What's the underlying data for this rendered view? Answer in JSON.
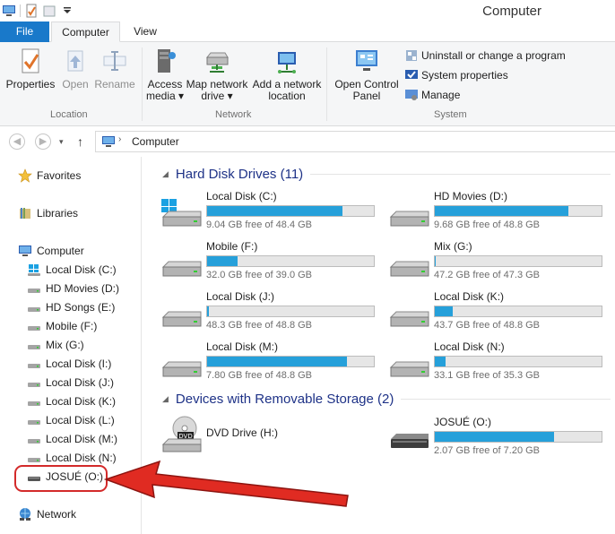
{
  "window": {
    "title": "Computer"
  },
  "tabs": {
    "file": "File",
    "computer": "Computer",
    "view": "View"
  },
  "ribbon": {
    "location": {
      "label": "Location",
      "properties": "Properties",
      "open": "Open",
      "rename": "Rename"
    },
    "network": {
      "label": "Network",
      "access_media": [
        "Access",
        "media ▾"
      ],
      "map_drive": [
        "Map network",
        "drive ▾"
      ],
      "add_location": [
        "Add a network",
        "location"
      ]
    },
    "system": {
      "label": "System",
      "open_cp": [
        "Open Control",
        "Panel"
      ],
      "uninstall": "Uninstall or change a program",
      "sysprops": "System properties",
      "manage": "Manage"
    }
  },
  "address": {
    "path": "Computer"
  },
  "nav": {
    "favorites": "Favorites",
    "libraries": "Libraries",
    "computer": "Computer",
    "drives": [
      "Local Disk (C:)",
      "HD Movies (D:)",
      "HD Songs (E:)",
      "Mobile (F:)",
      "Mix (G:)",
      "Local Disk (I:)",
      "Local Disk (J:)",
      "Local Disk (K:)",
      "Local Disk (L:)",
      "Local Disk (M:)",
      "Local Disk (N:)",
      "JOSUÉ (O:)"
    ],
    "network": "Network"
  },
  "content": {
    "hdd_title": "Hard Disk Drives (11)",
    "removable_title": "Devices with Removable Storage (2)",
    "hdd": [
      {
        "name": "Local Disk (C:)",
        "free": "9.04 GB free of 48.4 GB",
        "used_fraction": 0.813
      },
      {
        "name": "HD Movies (D:)",
        "free": "9.68 GB free of 48.8 GB",
        "used_fraction": 0.802
      },
      {
        "name": "Mobile (F:)",
        "free": "32.0 GB free of 39.0 GB",
        "used_fraction": 0.18
      },
      {
        "name": "Mix (G:)",
        "free": "47.2 GB free of 47.3 GB",
        "used_fraction": 0.005
      },
      {
        "name": "Local Disk (J:)",
        "free": "48.3 GB free of 48.8 GB",
        "used_fraction": 0.01
      },
      {
        "name": "Local Disk (K:)",
        "free": "43.7 GB free of 48.8 GB",
        "used_fraction": 0.105
      },
      {
        "name": "Local Disk (M:)",
        "free": "7.80 GB free of 48.8 GB",
        "used_fraction": 0.84
      },
      {
        "name": "Local Disk (N:)",
        "free": "33.1 GB free of 35.3 GB",
        "used_fraction": 0.062
      }
    ],
    "removable": [
      {
        "name": "DVD Drive (H:)"
      },
      {
        "name": "JOSUÉ (O:)",
        "free": "2.07 GB free of 7.20 GB",
        "used_fraction": 0.713
      }
    ]
  },
  "colors": {
    "accent": "#1979ca",
    "bar_fill": "#26a0da",
    "section_title": "#1e3287",
    "annotation": "#d32a2a"
  }
}
